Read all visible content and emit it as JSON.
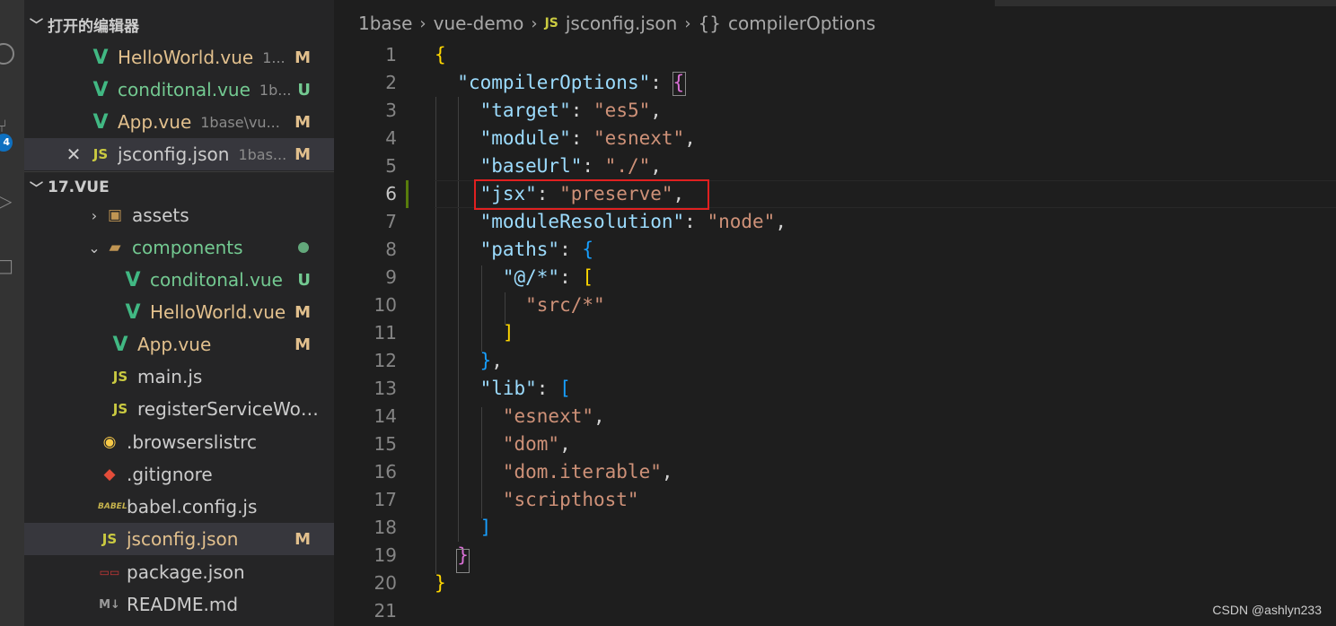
{
  "sidebar": {
    "open_editors": {
      "title": "打开的编辑器",
      "items": [
        {
          "name": "HelloWorld.vue",
          "desc": "1...",
          "status": "M",
          "icon": "vue-icon"
        },
        {
          "name": "conditonal.vue",
          "desc": "1b...",
          "status": "U",
          "icon": "vue-icon"
        },
        {
          "name": "App.vue",
          "desc": "1base\\vu...",
          "status": "M",
          "icon": "vue-icon"
        },
        {
          "name": "jsconfig.json",
          "desc": "1bas...",
          "status": "M",
          "icon": "js-icon"
        }
      ]
    },
    "explorer": {
      "title": "17.VUE",
      "items": [
        {
          "name": "assets",
          "icon": "folder-icon"
        },
        {
          "name": "components",
          "icon": "folder-open-icon"
        },
        {
          "name": "conditonal.vue",
          "status": "U",
          "icon": "vue-icon"
        },
        {
          "name": "HelloWorld.vue",
          "status": "M",
          "icon": "vue-icon"
        },
        {
          "name": "App.vue",
          "status": "M",
          "icon": "vue-icon"
        },
        {
          "name": "main.js",
          "icon": "js-icon"
        },
        {
          "name": "registerServiceWork...",
          "icon": "js-icon"
        },
        {
          "name": ".browserslistrc",
          "icon": "browserslist-icon"
        },
        {
          "name": ".gitignore",
          "icon": "git-icon"
        },
        {
          "name": "babel.config.js",
          "icon": "babel-icon"
        },
        {
          "name": "jsconfig.json",
          "status": "M",
          "icon": "js-icon"
        },
        {
          "name": "package.json",
          "icon": "npm-icon"
        },
        {
          "name": "README.md",
          "icon": "markdown-icon"
        }
      ]
    },
    "badge_count": "4"
  },
  "breadcrumb": {
    "parts": [
      "1base",
      "vue-demo",
      "jsconfig.json",
      "compilerOptions"
    ],
    "js_glyph": "JS",
    "braces_glyph": "{}"
  },
  "editor": {
    "line_numbers": [
      "1",
      "2",
      "3",
      "4",
      "5",
      "6",
      "7",
      "8",
      "9",
      "10",
      "11",
      "12",
      "13",
      "14",
      "15",
      "16",
      "17",
      "18",
      "19",
      "20",
      "21"
    ],
    "current_line": "6"
  },
  "watermark": "CSDN @ashlyn233"
}
